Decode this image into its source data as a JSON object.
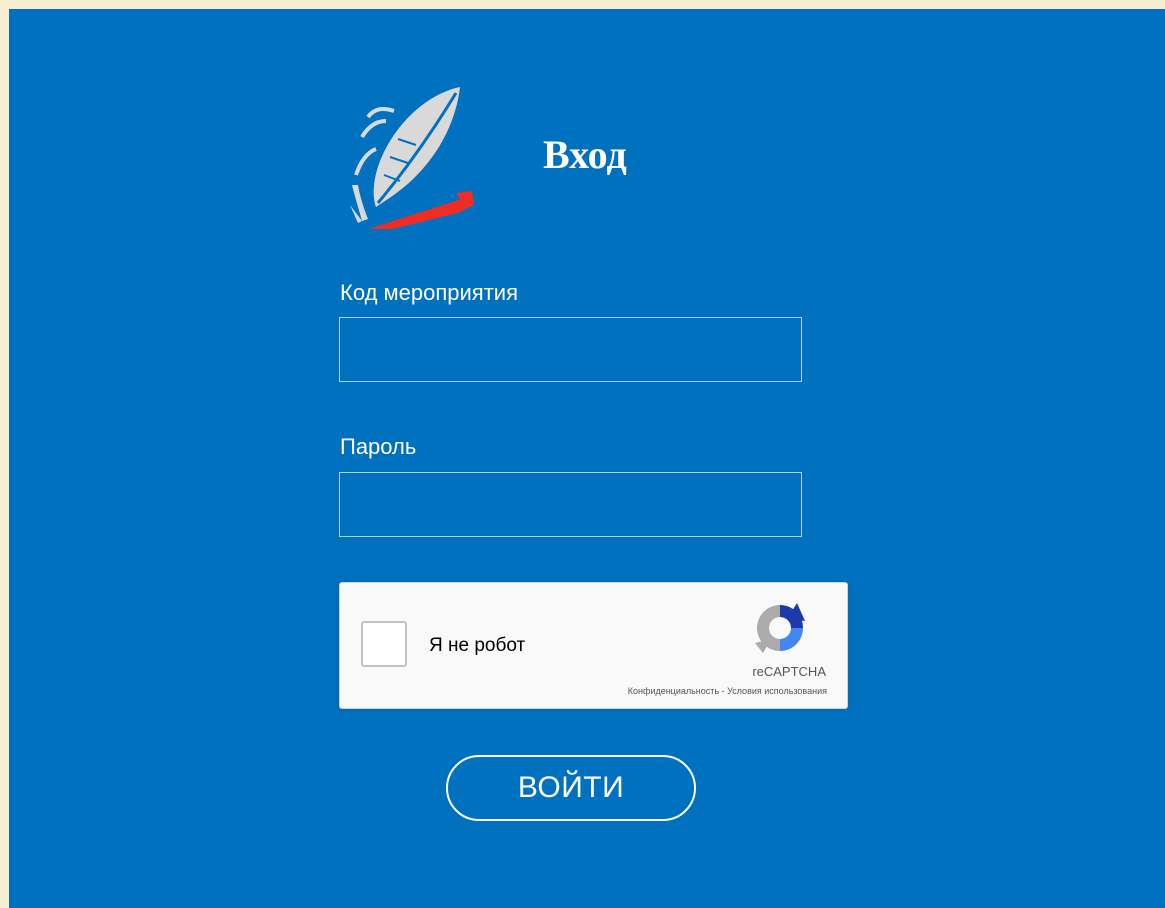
{
  "page": {
    "title": "Вход"
  },
  "form": {
    "event_code_label": "Код мероприятия",
    "event_code_value": "",
    "password_label": "Пароль",
    "password_value": "",
    "submit_label": "ВОЙТИ"
  },
  "captcha": {
    "label": "Я не робот",
    "checked": false,
    "brand": "reCAPTCHA",
    "privacy_link": "Конфиденциальность",
    "separator": " - ",
    "terms_link": "Условия использования"
  },
  "colors": {
    "page_border": "#f8edd0",
    "panel_background": "#0071bf",
    "text": "#ffffff",
    "logo_feather": "#d9d9d9",
    "logo_accent": "#ee2d24"
  },
  "icons": {
    "logo": "quill-feather-logo",
    "captcha": "recaptcha-logo-icon"
  }
}
